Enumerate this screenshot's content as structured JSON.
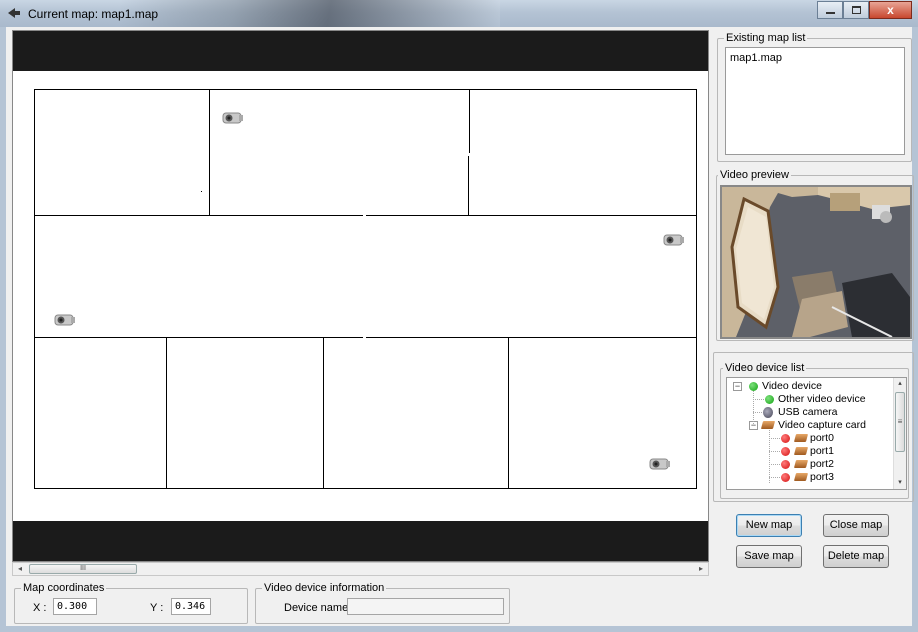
{
  "window": {
    "title": "Current map: map1.map",
    "close_glyph": "x"
  },
  "map_list": {
    "label": "Existing map list",
    "items": [
      "map1.map"
    ]
  },
  "video_preview": {
    "label": "Video preview"
  },
  "device_list": {
    "label": "Video device list",
    "root": "Video device",
    "other": "Other video device",
    "usb": "USB camera",
    "capture": "Video capture card",
    "ports": [
      "port0",
      "port1",
      "port2",
      "port3"
    ],
    "collapse_glyph": "−"
  },
  "buttons": {
    "new_map": "New map",
    "close_map": "Close map",
    "save_map": "Save map",
    "delete_map": "Delete map"
  },
  "coordinates": {
    "label": "Map coordinates",
    "x_label": "X :",
    "x_value": "0.300",
    "y_label": "Y :",
    "y_value": "0.346"
  },
  "device_info": {
    "label": "Video device information",
    "name_label": "Device name:",
    "name_value": ""
  },
  "scrollbar": {
    "left": "◂",
    "right": "▸",
    "grip": "III",
    "up": "▴",
    "down": "▾",
    "vgrip": "≡"
  },
  "icons": {
    "camera": "camera-icon",
    "device_status_online": "#1aa51a",
    "device_status_offline": "#d41010"
  }
}
